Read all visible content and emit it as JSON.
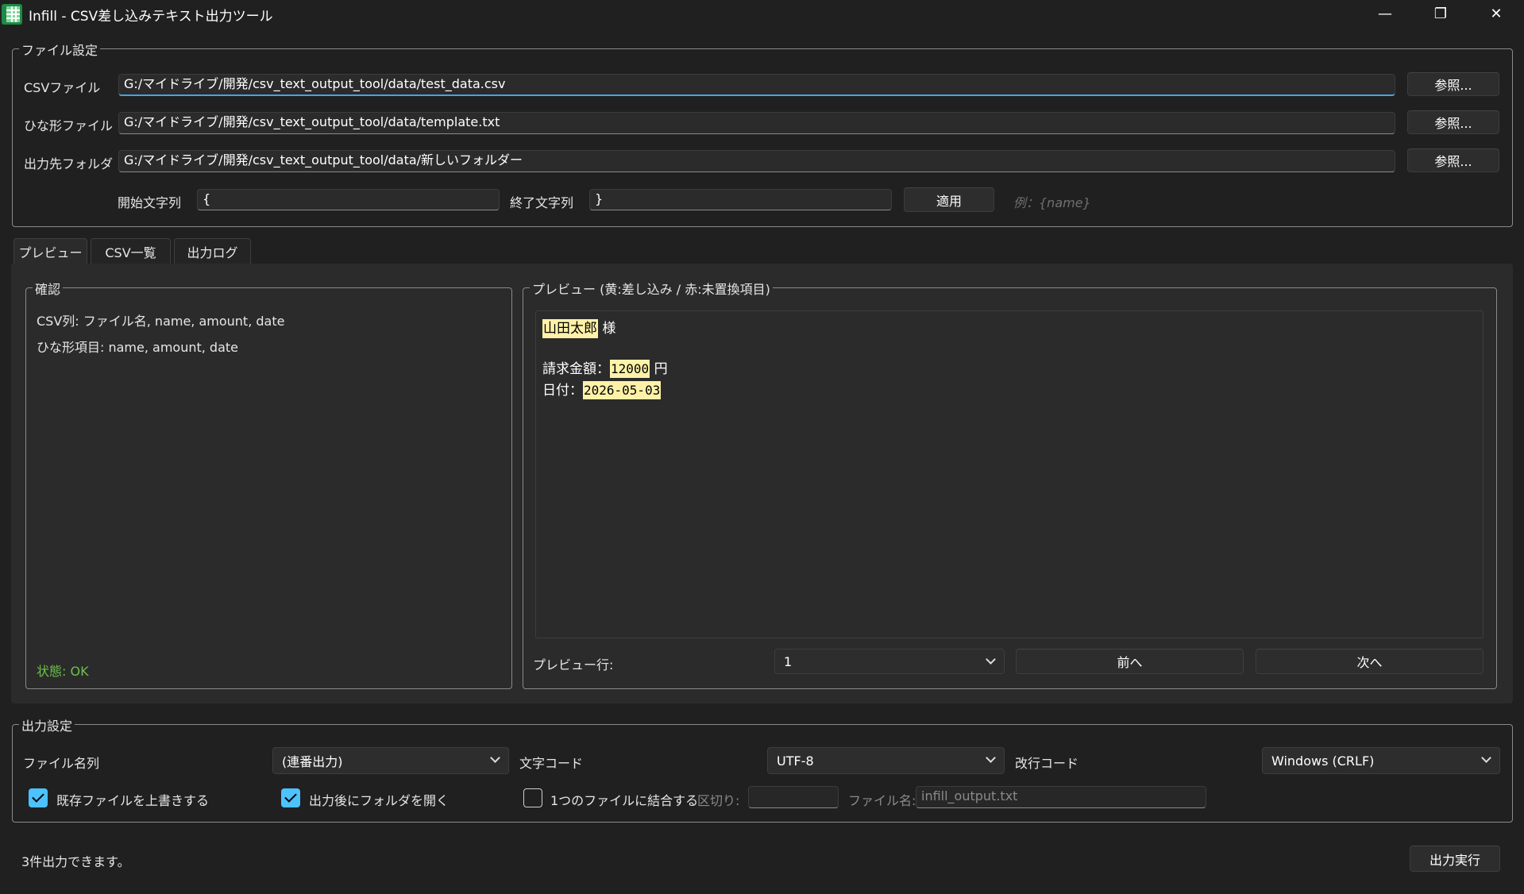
{
  "window": {
    "title": "Infill - CSV差し込みテキスト出力ツール",
    "minimize": "—",
    "restore": "❐",
    "close": "✕"
  },
  "file_settings": {
    "group_title": "ファイル設定",
    "csv_label": "CSVファイル",
    "csv_path": "G:/マイドライブ/開発/csv_text_output_tool/data/test_data.csv",
    "template_label": "ひな形ファイル",
    "template_path": "G:/マイドライブ/開発/csv_text_output_tool/data/template.txt",
    "output_label": "出力先フォルダ",
    "output_path": "G:/マイドライブ/開発/csv_text_output_tool/data/新しいフォルダー",
    "browse_label": "参照...",
    "start_label": "開始文字列",
    "start_value": "{",
    "end_label": "終了文字列",
    "end_value": "}",
    "apply_label": "適用",
    "example_hint": "例：{name}"
  },
  "tabs": [
    {
      "label": "プレビュー",
      "active": true
    },
    {
      "label": "CSV一覧",
      "active": false
    },
    {
      "label": "出力ログ",
      "active": false
    }
  ],
  "confirm": {
    "group_title": "確認",
    "csv_columns": "CSV列: ファイル名, name, amount, date",
    "template_items": "ひな形項目: name, amount, date",
    "status": "状態: OK"
  },
  "preview": {
    "group_title": "プレビュー (黄:差し込み / 赤:未置換項目)",
    "line1": {
      "value": "山田太郎",
      "suffix": " 様"
    },
    "line2": {
      "prefix": "請求金額：",
      "value": "12000",
      "suffix": " 円"
    },
    "line3": {
      "prefix": "日付：",
      "value": "2026-05-03"
    },
    "row_label": "プレビュー行:",
    "row_value": "1",
    "prev_label": "前へ",
    "next_label": "次へ"
  },
  "output_settings": {
    "group_title": "出力設定",
    "filename_col_label": "ファイル名列",
    "filename_col_value": "(連番出力)",
    "encoding_label": "文字コード",
    "encoding_value": "UTF-8",
    "newline_label": "改行コード",
    "newline_value": "Windows (CRLF)",
    "overwrite_label": "既存ファイルを上書きする",
    "overwrite_checked": true,
    "open_folder_label": "出力後にフォルダを開く",
    "open_folder_checked": true,
    "combine_label": "1つのファイルに結合する",
    "combine_checked": false,
    "separator_label": "区切り:",
    "separator_value": "",
    "combined_filename_label": "ファイル名:",
    "combined_filename_placeholder": "infill_output.txt"
  },
  "footer": {
    "status_text": "3件出力できます。",
    "run_label": "出力実行"
  },
  "colors": {
    "background": "#202020",
    "accent": "#4cc2ff",
    "highlight": "#fff2a8",
    "ok": "#6cc24a"
  }
}
